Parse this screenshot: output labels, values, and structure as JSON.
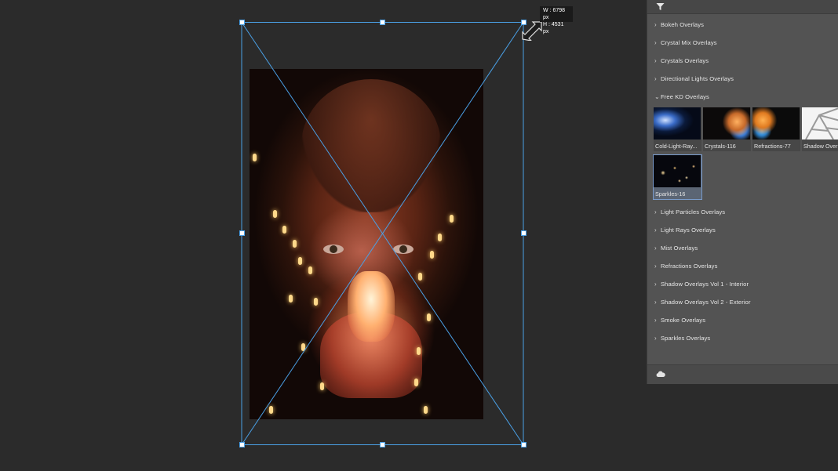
{
  "canvas": {
    "size_tooltip": {
      "width": "W : 6798 px",
      "height": "H : 4531 px"
    }
  },
  "panel": {
    "header_icon": "filter-icon",
    "folders_above": [
      {
        "label": "Bokeh Overlays",
        "expanded": false
      },
      {
        "label": "Crystal Mix Overlays",
        "expanded": false
      },
      {
        "label": "Crystals Overlays",
        "expanded": false
      },
      {
        "label": "Directional Lights Overlays",
        "expanded": false
      },
      {
        "label": "Free KD Overlays",
        "expanded": true
      }
    ],
    "thumbnails": [
      {
        "label": "Cold-Light-Ray...",
        "selected": false
      },
      {
        "label": "Crystals-116",
        "selected": false
      },
      {
        "label": "Refractions-77",
        "selected": false
      },
      {
        "label": "Shadow Over",
        "selected": false
      },
      {
        "label": "Sparkles-16",
        "selected": true
      }
    ],
    "folders_below": [
      {
        "label": "Light Particles Overlays",
        "expanded": false
      },
      {
        "label": "Light Rays Overlays",
        "expanded": false
      },
      {
        "label": "Mist Overlays",
        "expanded": false
      },
      {
        "label": "Refractions Overlays",
        "expanded": false
      },
      {
        "label": "Shadow Overlays Vol 1 - Interior",
        "expanded": false
      },
      {
        "label": "Shadow Overlays Vol 2 - Exterior",
        "expanded": false
      },
      {
        "label": "Smoke Overlays",
        "expanded": false
      },
      {
        "label": "Sparkles Overlays",
        "expanded": false
      }
    ],
    "footer_icon": "cloud-icon"
  },
  "colors": {
    "canvas_bg": "#2b2b2b",
    "panel_bg": "#535353",
    "transform_line": "#4aa0e6",
    "selected_thumb": "#5b6574"
  }
}
